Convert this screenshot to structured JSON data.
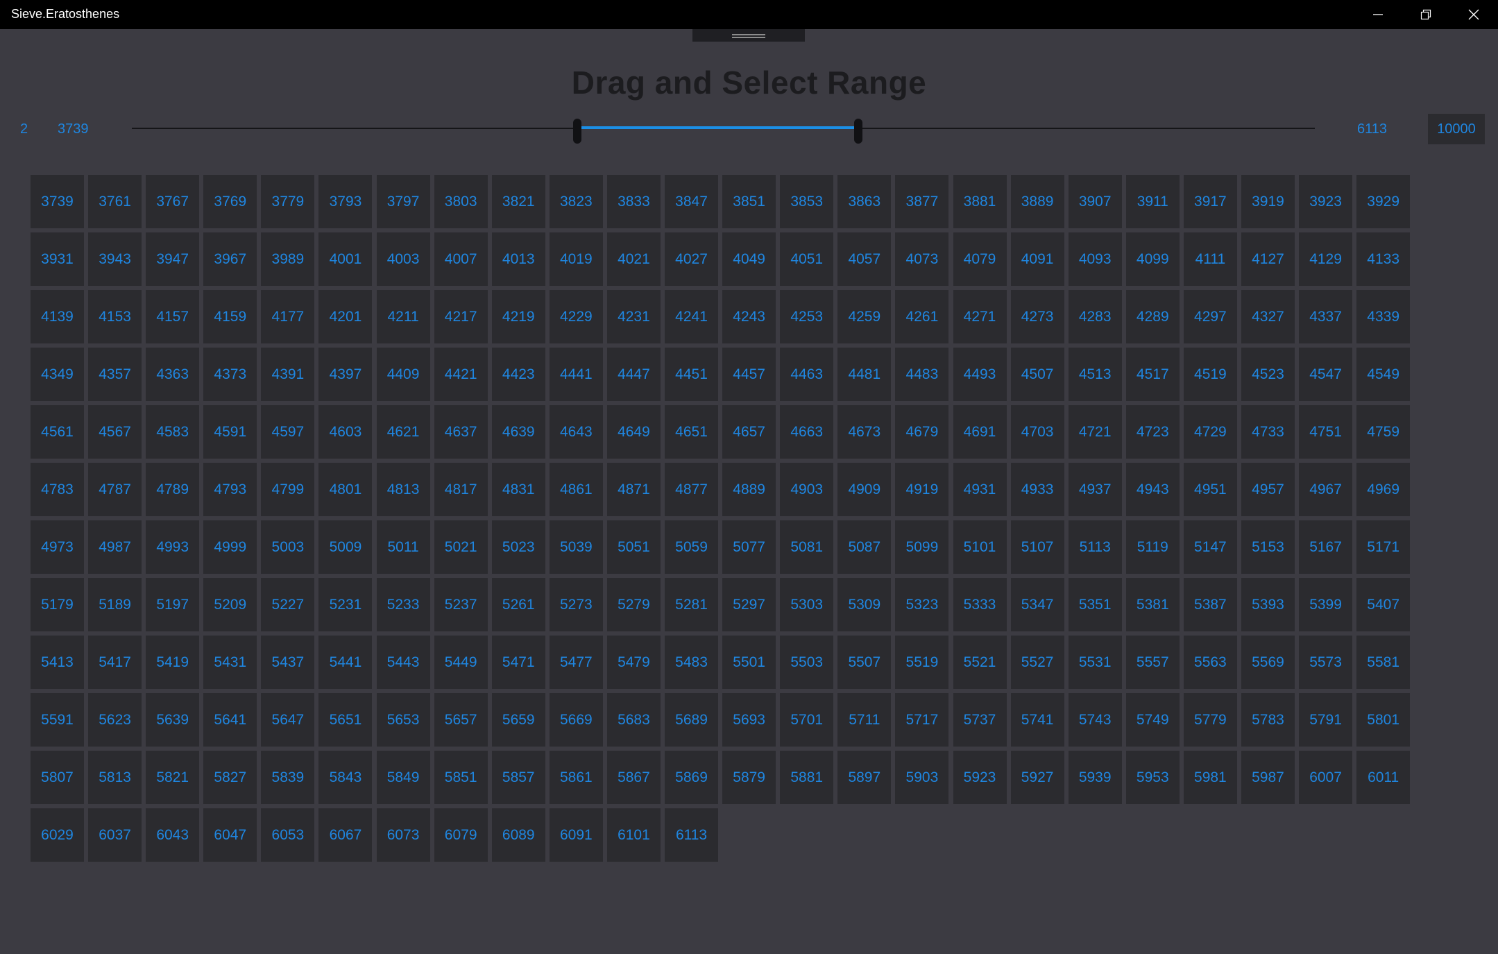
{
  "window": {
    "title": "Sieve.Eratosthenes",
    "minimize_icon": "minimize-icon",
    "maximize_icon": "restore-icon",
    "close_icon": "close-icon"
  },
  "header": {
    "title": "Drag and Select Range"
  },
  "range": {
    "min": "2",
    "selected_low": "3739",
    "selected_high": "6113",
    "max": "10000"
  },
  "colors": {
    "background": "#3c3b42",
    "cell": "#2b2b2f",
    "accent": "#1f86e0",
    "titlebar": "#000000"
  },
  "primes": [
    "3739",
    "3761",
    "3767",
    "3769",
    "3779",
    "3793",
    "3797",
    "3803",
    "3821",
    "3823",
    "3833",
    "3847",
    "3851",
    "3853",
    "3863",
    "3877",
    "3881",
    "3889",
    "3907",
    "3911",
    "3917",
    "3919",
    "3923",
    "3929",
    "3931",
    "3943",
    "3947",
    "3967",
    "3989",
    "4001",
    "4003",
    "4007",
    "4013",
    "4019",
    "4021",
    "4027",
    "4049",
    "4051",
    "4057",
    "4073",
    "4079",
    "4091",
    "4093",
    "4099",
    "4111",
    "4127",
    "4129",
    "4133",
    "4139",
    "4153",
    "4157",
    "4159",
    "4177",
    "4201",
    "4211",
    "4217",
    "4219",
    "4229",
    "4231",
    "4241",
    "4243",
    "4253",
    "4259",
    "4261",
    "4271",
    "4273",
    "4283",
    "4289",
    "4297",
    "4327",
    "4337",
    "4339",
    "4349",
    "4357",
    "4363",
    "4373",
    "4391",
    "4397",
    "4409",
    "4421",
    "4423",
    "4441",
    "4447",
    "4451",
    "4457",
    "4463",
    "4481",
    "4483",
    "4493",
    "4507",
    "4513",
    "4517",
    "4519",
    "4523",
    "4547",
    "4549",
    "4561",
    "4567",
    "4583",
    "4591",
    "4597",
    "4603",
    "4621",
    "4637",
    "4639",
    "4643",
    "4649",
    "4651",
    "4657",
    "4663",
    "4673",
    "4679",
    "4691",
    "4703",
    "4721",
    "4723",
    "4729",
    "4733",
    "4751",
    "4759",
    "4783",
    "4787",
    "4789",
    "4793",
    "4799",
    "4801",
    "4813",
    "4817",
    "4831",
    "4861",
    "4871",
    "4877",
    "4889",
    "4903",
    "4909",
    "4919",
    "4931",
    "4933",
    "4937",
    "4943",
    "4951",
    "4957",
    "4967",
    "4969",
    "4973",
    "4987",
    "4993",
    "4999",
    "5003",
    "5009",
    "5011",
    "5021",
    "5023",
    "5039",
    "5051",
    "5059",
    "5077",
    "5081",
    "5087",
    "5099",
    "5101",
    "5107",
    "5113",
    "5119",
    "5147",
    "5153",
    "5167",
    "5171",
    "5179",
    "5189",
    "5197",
    "5209",
    "5227",
    "5231",
    "5233",
    "5237",
    "5261",
    "5273",
    "5279",
    "5281",
    "5297",
    "5303",
    "5309",
    "5323",
    "5333",
    "5347",
    "5351",
    "5381",
    "5387",
    "5393",
    "5399",
    "5407",
    "5413",
    "5417",
    "5419",
    "5431",
    "5437",
    "5441",
    "5443",
    "5449",
    "5471",
    "5477",
    "5479",
    "5483",
    "5501",
    "5503",
    "5507",
    "5519",
    "5521",
    "5527",
    "5531",
    "5557",
    "5563",
    "5569",
    "5573",
    "5581",
    "5591",
    "5623",
    "5639",
    "5641",
    "5647",
    "5651",
    "5653",
    "5657",
    "5659",
    "5669",
    "5683",
    "5689",
    "5693",
    "5701",
    "5711",
    "5717",
    "5737",
    "5741",
    "5743",
    "5749",
    "5779",
    "5783",
    "5791",
    "5801",
    "5807",
    "5813",
    "5821",
    "5827",
    "5839",
    "5843",
    "5849",
    "5851",
    "5857",
    "5861",
    "5867",
    "5869",
    "5879",
    "5881",
    "5897",
    "5903",
    "5923",
    "5927",
    "5939",
    "5953",
    "5981",
    "5987",
    "6007",
    "6011",
    "6029",
    "6037",
    "6043",
    "6047",
    "6053",
    "6067",
    "6073",
    "6079",
    "6089",
    "6091",
    "6101",
    "6113"
  ]
}
